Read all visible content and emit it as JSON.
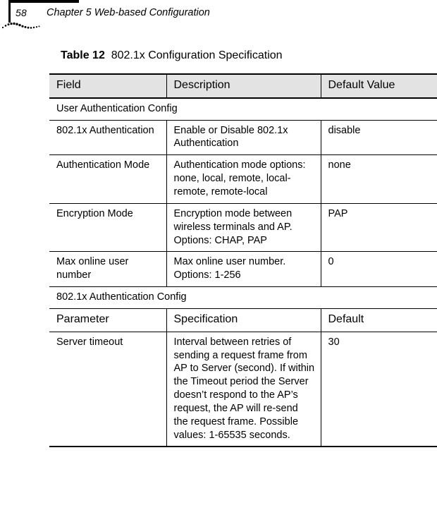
{
  "header": {
    "page_number": "58",
    "chapter_title": "Chapter 5 Web-based Configuration",
    "decoration": "dotted-wave-ornament"
  },
  "caption": {
    "label": "Table 12",
    "text": "802.1x Configuration Specification"
  },
  "colors": {
    "header_row_background": "#e3e3e3",
    "rule": "#000000",
    "page_background": "#ffffff",
    "text": "#000000"
  },
  "table": {
    "columns_block1": [
      "Field",
      "Description",
      "Default Value"
    ],
    "columns_block2": [
      "Parameter",
      "Specification",
      "Default"
    ],
    "section1": {
      "title": "User Authentication Config",
      "rows": [
        {
          "field": "802.1x Authentication",
          "description": "Enable or Disable 802.1x Authentication",
          "default": "disable"
        },
        {
          "field": "Authentication Mode",
          "description": "Authentication mode options: none, local, remote, local-remote, remote-local",
          "default": "none"
        },
        {
          "field": "Encryption Mode",
          "description": "Encryption mode between wireless terminals and AP. Options: CHAP, PAP",
          "default": "PAP"
        },
        {
          "field": "Max online user number",
          "description": "Max online user number. Options: 1-256",
          "default": "0"
        }
      ]
    },
    "section2": {
      "title": "802.1x Authentication Config",
      "rows": [
        {
          "parameter": "Server timeout",
          "specification": "Interval between retries of sending a request frame from AP to Server (second). If within the Timeout period the Server doesn’t respond to the AP’s request, the AP will re-send the request frame. Possible values: 1-65535 seconds.",
          "default": "30"
        }
      ]
    }
  }
}
